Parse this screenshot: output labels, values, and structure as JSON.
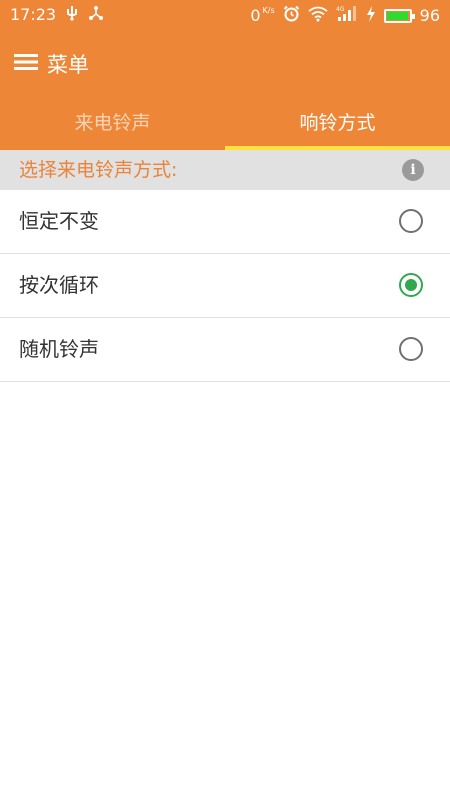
{
  "status_bar": {
    "time": "17:23",
    "net_speed_value": "0",
    "net_speed_unit": "K/s",
    "battery_percent": "96",
    "battery_level": 0.96,
    "icons": [
      "usb-icon",
      "share-icon",
      "alarm-icon",
      "wifi-icon",
      "signal-4g-icon",
      "charging-icon",
      "battery-icon"
    ]
  },
  "toolbar": {
    "menu_label": "菜单"
  },
  "tabs": [
    {
      "label": "来电铃声",
      "active": false
    },
    {
      "label": "响铃方式",
      "active": true
    }
  ],
  "section": {
    "title": "选择来电铃声方式:",
    "icon": "info-icon"
  },
  "options": [
    {
      "label": "恒定不变",
      "selected": false
    },
    {
      "label": "按次循环",
      "selected": true
    },
    {
      "label": "随机铃声",
      "selected": false
    }
  ],
  "colors": {
    "primary": "#ED8637",
    "tab_indicator": "#FFE13C",
    "radio_checked": "#2FA84F",
    "section_text": "#E9843A",
    "section_bg": "#E1E1E1"
  }
}
